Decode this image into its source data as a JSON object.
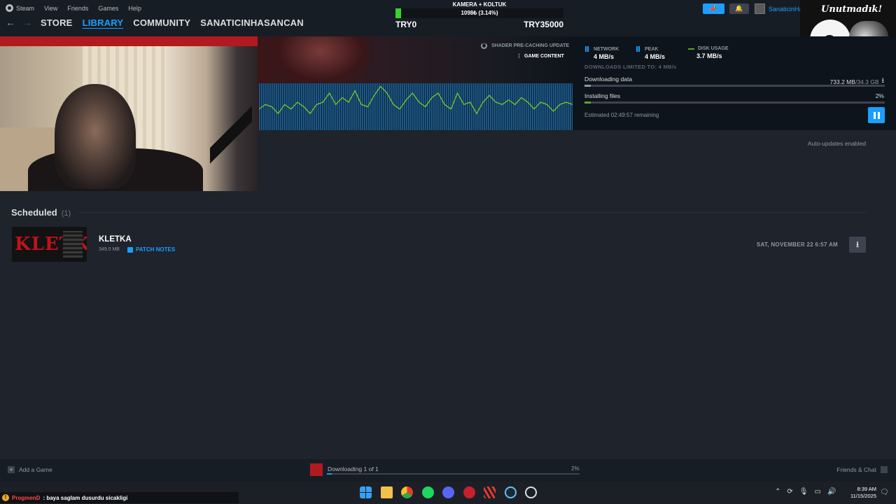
{
  "menu": {
    "app": "Steam",
    "items": [
      "View",
      "Friends",
      "Games",
      "Help"
    ]
  },
  "nav": {
    "back": "←",
    "forward": "→",
    "links": [
      "STORE",
      "LIBRARY",
      "COMMUNITY",
      "SANATICINHASANCAN"
    ]
  },
  "goal": {
    "title": "KAMERA + KOLTUK",
    "amount_text": "1098₺ (3.14%)",
    "progress_fraction": 0.0314,
    "min_label": "TRY0",
    "max_label": "TRY35000"
  },
  "topright": {
    "username": "SanaticinHasancan",
    "overlay_title": "Unutmadık!"
  },
  "download": {
    "shader_update": "SHADER PRE-CACHING UPDATE",
    "game_content": "GAME CONTENT",
    "stats": {
      "network_label": "NETWORK",
      "network_value": "4 MB/s",
      "peak_label": "PEAK",
      "peak_value": "4 MB/s",
      "disk_label": "DISK USAGE",
      "disk_value": "3.7 MB/s"
    },
    "limit": "DOWNLOADS LIMITED TO: 4 MB/s",
    "downloading_label": "Downloading data",
    "downloaded": "733.2 MB",
    "separator": " / ",
    "total": "34.3 GB",
    "download_fraction": 0.021,
    "installing_label": "Installing files",
    "installing_pct": "2%",
    "installing_fraction": 0.02,
    "remaining": "Estimated 02:49:57 remaining",
    "graph_series": [
      0.45,
      0.55,
      0.5,
      0.35,
      0.55,
      0.45,
      0.6,
      0.5,
      0.35,
      0.55,
      0.6,
      0.8,
      0.55,
      0.7,
      0.6,
      0.85,
      0.55,
      0.5,
      0.75,
      0.95,
      0.8,
      0.55,
      0.45,
      0.65,
      0.8,
      0.6,
      0.5,
      0.7,
      0.8,
      0.55,
      0.45,
      0.8,
      0.55,
      0.6,
      0.35,
      0.6,
      0.75,
      0.6,
      0.55,
      0.65,
      0.55,
      0.7,
      0.6,
      0.45,
      0.6,
      0.55,
      0.4,
      0.55,
      0.6,
      0.55
    ]
  },
  "auto_updates": "Auto-updates enabled",
  "scheduled": {
    "title": "Scheduled",
    "count": "(1)",
    "items": [
      {
        "thumb_text": "KLETKA",
        "name": "KLETKA",
        "size": "349.0 MB",
        "patch_notes": "PATCH NOTES",
        "date": "SAT, NOVEMBER 22 6:57 AM"
      }
    ]
  },
  "bottom": {
    "add_game": "Add a Game",
    "downloading": "Downloading 1 of 1",
    "pct": "2%",
    "progress_fraction": 0.02,
    "friends_chat": "Friends & Chat"
  },
  "chat_overlay": {
    "nick": "ProgmenD",
    "message": ": baya saglam dusurdu sicakligi"
  },
  "taskbar": {
    "time": "8:39 AM",
    "date": "11/15/2025"
  }
}
